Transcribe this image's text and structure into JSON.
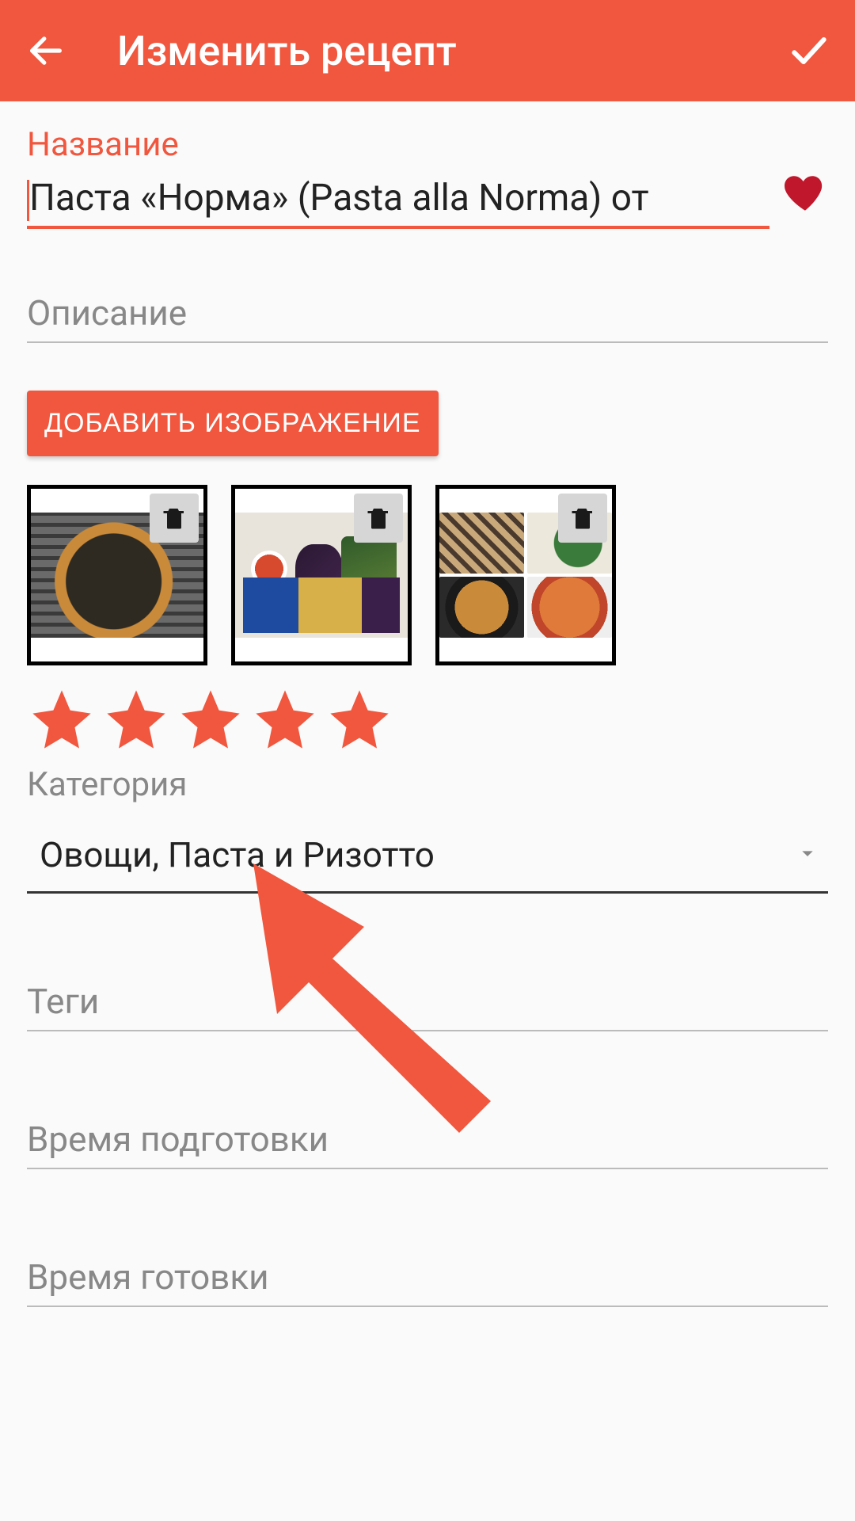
{
  "colors": {
    "accent": "#f0573e",
    "heart": "#c1172c"
  },
  "appbar": {
    "title": "Изменить рецепт"
  },
  "title_field": {
    "label": "Название",
    "value": "Паста «Норма» (Pasta alla Norma) от"
  },
  "description": {
    "placeholder": "Описание"
  },
  "add_image_button": "ДОБАВИТЬ ИЗОБРАЖЕНИЕ",
  "images": {
    "count": 3
  },
  "rating": {
    "value": 5,
    "max": 5
  },
  "category": {
    "label": "Категория",
    "value": "Овощи, Паста и Ризотто"
  },
  "tags": {
    "placeholder": "Теги"
  },
  "prep_time": {
    "placeholder": "Время подготовки"
  },
  "cook_time": {
    "placeholder": "Время готовки"
  }
}
